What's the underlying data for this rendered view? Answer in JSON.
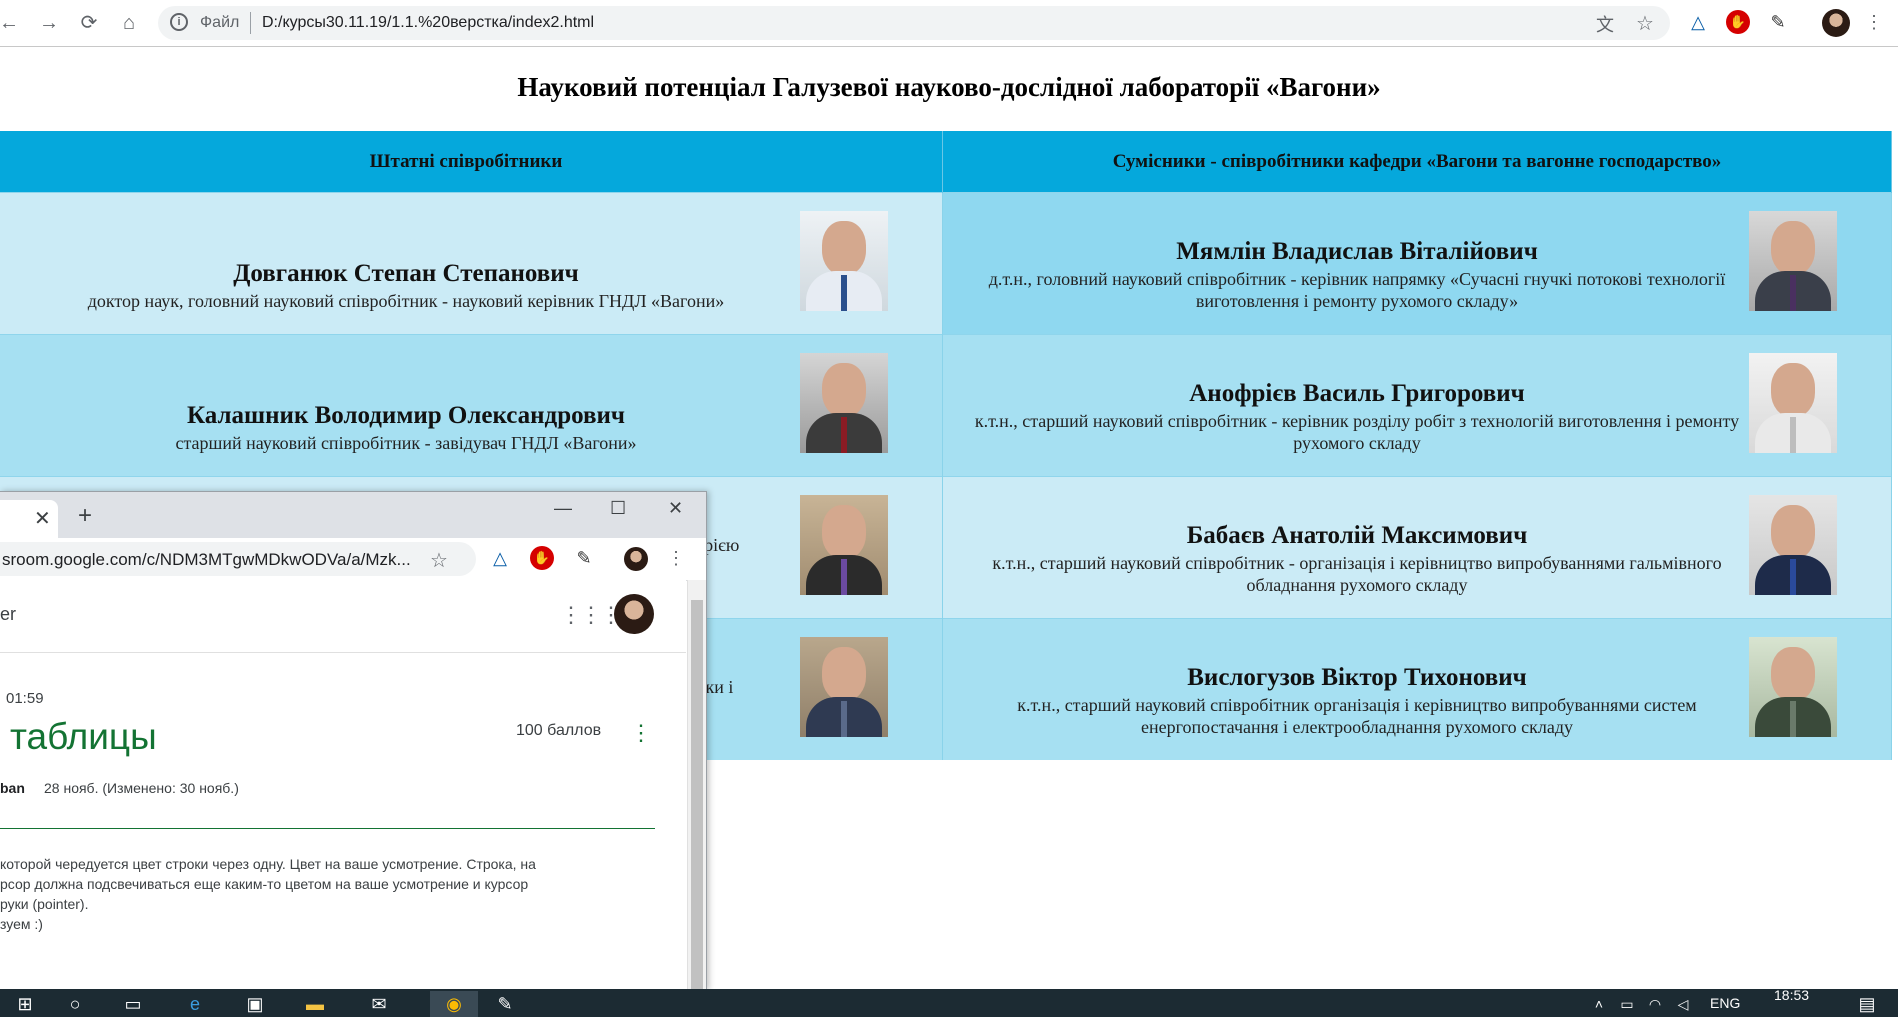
{
  "browser": {
    "omnibox_file_label": "Файл",
    "url": "D:/курсы30.11.19/1.1.%20верстка/index2.html",
    "nav": {
      "back": "←",
      "forward": "→",
      "reload": "⟳",
      "home": "⌂"
    }
  },
  "page": {
    "title": "Науковий потенціал Галузевої науково-дослідної лабораторії «Вагони»",
    "columns": [
      "Штатні співробітники",
      "Сумісники - співробітники кафедри «Вагони та вагонне господарство»"
    ],
    "rows": [
      {
        "left": {
          "name": "Довганюк Степан Степанович",
          "desc": "доктор наук, головний науковий співробітник - науковий керівник ГНДЛ «Вагони»"
        },
        "right": {
          "name": "Мямлін Владислав Віталійович",
          "desc": "д.т.н., головний науковий співробітник - керівник напрямку «Сучасні гнучкі потокові технології виготовлення і ремонту рухомого складу»"
        }
      },
      {
        "left": {
          "name": "Калашник Володимир Олександрович",
          "desc": "старший науковий співробітник - завідувач ГНДЛ «Вагони»"
        },
        "right": {
          "name": "Анофрієв Василь Григорович",
          "desc": "к.т.н., старший науковий співробітник - керівник розділу робіт з технологій виготовлення і ремонту рухомого складу"
        }
      },
      {
        "left": {
          "name": "",
          "desc": "аторією"
        },
        "right": {
          "name": "Бабаєв Анатолій Максимович",
          "desc": "к.т.н., старший науковий співробітник - організація і керівництво випробуваннями гальмівного обладнання рухомого складу"
        }
      },
      {
        "left": {
          "name": "",
          "desc": "стики і"
        },
        "right": {
          "name": "Вислогузов Віктор Тихонович",
          "desc": "к.т.н., старший науковий співробітник організація і керівництво випробуваннями систем енергопостачання і електрообладнання рухомого складу"
        }
      }
    ]
  },
  "popup": {
    "url": "sroom.google.com/c/NDM3MTgwMDkwODVa/a/Mzk...",
    "header_text": "er",
    "time_text": "01:59",
    "assignment_title": "таблицы",
    "points": "100 баллов",
    "author": "ban",
    "date": "28 нояб. (Изменено: 30 нояб.)",
    "body_lines": [
      "которой чередуется цвет строки через одну. Цвет на ваше усмотрение. Строка, на",
      "рсор должна подсвечиваться еще каким-то цветом на ваше усмотрение и курсор",
      "руки (pointer).",
      "зуем :)"
    ]
  },
  "taskbar": {
    "language": "ENG",
    "time": "18:53"
  },
  "colors": {
    "header": "#05a8dc",
    "row_light": "#cbebf6",
    "row_dark": "#a6e0f2",
    "classroom_teal": "#137333"
  }
}
